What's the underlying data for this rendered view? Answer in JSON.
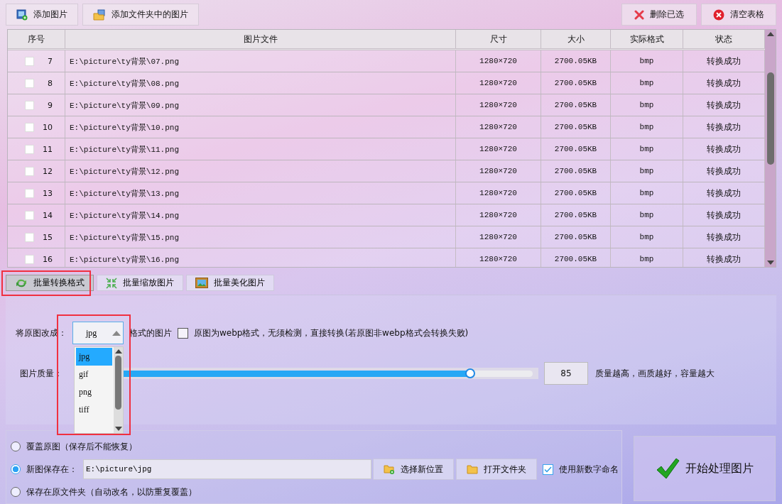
{
  "toolbar": {
    "left_buttons": [
      {
        "label": "添加图片",
        "kind": "add-image"
      },
      {
        "label": "添加文件夹中的图片",
        "kind": "add-folder"
      }
    ],
    "right_buttons": [
      {
        "label": "删除已选",
        "kind": "delete"
      },
      {
        "label": "清空表格",
        "kind": "clear"
      }
    ]
  },
  "table": {
    "columns": [
      "序号",
      "图片文件",
      "尺寸",
      "大小",
      "实际格式",
      "状态"
    ],
    "rows": [
      {
        "checked": false,
        "cells": [
          "7",
          "E:\\picture\\ty背景\\07.png",
          "1280×720",
          "2700.05KB",
          "bmp",
          "转换成功"
        ]
      },
      {
        "checked": false,
        "cells": [
          "8",
          "E:\\picture\\ty背景\\08.png",
          "1280×720",
          "2700.05KB",
          "bmp",
          "转换成功"
        ]
      },
      {
        "checked": false,
        "cells": [
          "9",
          "E:\\picture\\ty背景\\09.png",
          "1280×720",
          "2700.05KB",
          "bmp",
          "转换成功"
        ]
      },
      {
        "checked": false,
        "cells": [
          "10",
          "E:\\picture\\ty背景\\10.png",
          "1280×720",
          "2700.05KB",
          "bmp",
          "转换成功"
        ]
      },
      {
        "checked": false,
        "cells": [
          "11",
          "E:\\picture\\ty背景\\11.png",
          "1280×720",
          "2700.05KB",
          "bmp",
          "转换成功"
        ]
      },
      {
        "checked": false,
        "cells": [
          "12",
          "E:\\picture\\ty背景\\12.png",
          "1280×720",
          "2700.05KB",
          "bmp",
          "转换成功"
        ]
      },
      {
        "checked": false,
        "cells": [
          "13",
          "E:\\picture\\ty背景\\13.png",
          "1280×720",
          "2700.05KB",
          "bmp",
          "转换成功"
        ]
      },
      {
        "checked": false,
        "cells": [
          "14",
          "E:\\picture\\ty背景\\14.png",
          "1280×720",
          "2700.05KB",
          "bmp",
          "转换成功"
        ]
      },
      {
        "checked": false,
        "cells": [
          "15",
          "E:\\picture\\ty背景\\15.png",
          "1280×720",
          "2700.05KB",
          "bmp",
          "转换成功"
        ]
      },
      {
        "checked": false,
        "cells": [
          "16",
          "E:\\picture\\ty背景\\16.png",
          "1280×720",
          "2700.05KB",
          "bmp",
          "转换成功"
        ]
      }
    ]
  },
  "tabs": [
    {
      "label": "批量转换格式",
      "kind": "convert",
      "selected": true
    },
    {
      "label": "批量缩放图片",
      "kind": "resize",
      "selected": false
    },
    {
      "label": "批量美化图片",
      "kind": "beautify",
      "selected": false
    }
  ],
  "convert": {
    "format_label": "将原图改成：",
    "format_value": "jpg",
    "format_suffix": "格式的图片",
    "expanded": true,
    "format_options": [
      {
        "label": "jpg",
        "selected": true
      },
      {
        "label": "gif",
        "selected": false
      },
      {
        "label": "png",
        "selected": false
      },
      {
        "label": "tiff",
        "selected": false
      }
    ],
    "webp_checked": false,
    "webp_label": "原图为webp格式，无须检测，直接转换(若原图非webp格式会转换失败)",
    "quality_label": "图片质量：",
    "quality": {
      "level": 0.85
    },
    "quality_value": "85",
    "quality_hint": "质量越高，画质越好，容量越大"
  },
  "output": {
    "options": [
      {
        "label": "覆盖原图（保存后不能恢复）",
        "selected": false
      },
      {
        "label": "新图保存在：",
        "selected": true
      },
      {
        "label": "保存在原文件夹（自动改名，以防重复覆盖）",
        "selected": false
      }
    ],
    "path": "E:\\picture\\jpg",
    "choose_button": "选择新位置",
    "open_button": "打开文件夹",
    "rename_checked": true,
    "rename_label": "使用新数字命名"
  },
  "start_button": "开始处理图片"
}
